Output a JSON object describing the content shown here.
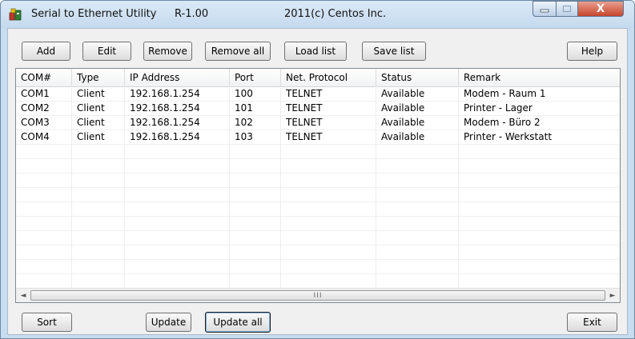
{
  "window": {
    "app_name": "Serial to Ethernet Utility",
    "version": "R-1.00",
    "copyright": "2011(c)  Centos Inc.",
    "close_glyph": "X",
    "icons": [
      "app-icon",
      "minimize-icon",
      "maximize-icon",
      "close-icon"
    ]
  },
  "toolbar": {
    "add": "Add",
    "edit": "Edit",
    "remove": "Remove",
    "remove_all": "Remove all",
    "load_list": "Load list",
    "save_list": "Save list",
    "help": "Help"
  },
  "table": {
    "columns": [
      "COM#",
      "Type",
      "IP Address",
      "Port",
      "Net. Protocol",
      "Status",
      "Remark"
    ],
    "rows": [
      [
        "COM1",
        "Client",
        "192.168.1.254",
        "100",
        "TELNET",
        "Available",
        "Modem - Raum 1"
      ],
      [
        "COM2",
        "Client",
        "192.168.1.254",
        "101",
        "TELNET",
        "Available",
        "Printer - Lager"
      ],
      [
        "COM3",
        "Client",
        "192.168.1.254",
        "102",
        "TELNET",
        "Available",
        "Modem - Büro 2"
      ],
      [
        "COM4",
        "Client",
        "192.168.1.254",
        "103",
        "TELNET",
        "Available",
        "Printer - Werkstatt"
      ]
    ],
    "scroll_grip": "III",
    "scroll_left_glyph": "◄",
    "scroll_right_glyph": "►"
  },
  "bottom": {
    "sort": "Sort",
    "update": "Update",
    "update_all": "Update all",
    "exit": "Exit"
  }
}
